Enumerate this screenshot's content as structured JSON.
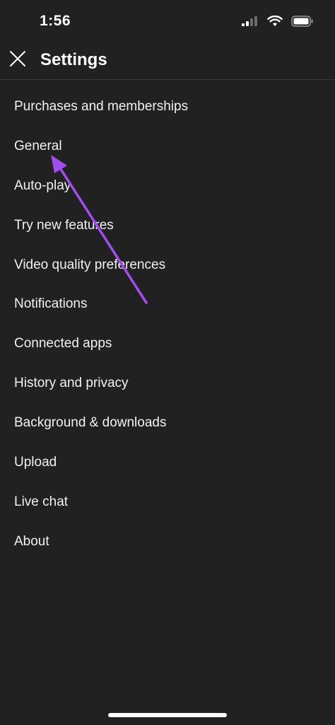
{
  "status_bar": {
    "time": "1:56",
    "icons": [
      "cellular-signal-icon",
      "wifi-icon",
      "battery-icon"
    ]
  },
  "header": {
    "title": "Settings",
    "close_icon": "close-icon"
  },
  "menu": {
    "items": [
      {
        "label": "Purchases and memberships"
      },
      {
        "label": "General"
      },
      {
        "label": "Auto-play"
      },
      {
        "label": "Try new features"
      },
      {
        "label": "Video quality preferences"
      },
      {
        "label": "Notifications"
      },
      {
        "label": "Connected apps"
      },
      {
        "label": "History and privacy"
      },
      {
        "label": "Background & downloads"
      },
      {
        "label": "Upload"
      },
      {
        "label": "Live chat"
      },
      {
        "label": "About"
      }
    ]
  },
  "colors": {
    "background": "#212121",
    "text": "#f1f1f1",
    "annotation_arrow": "#a24df0"
  }
}
